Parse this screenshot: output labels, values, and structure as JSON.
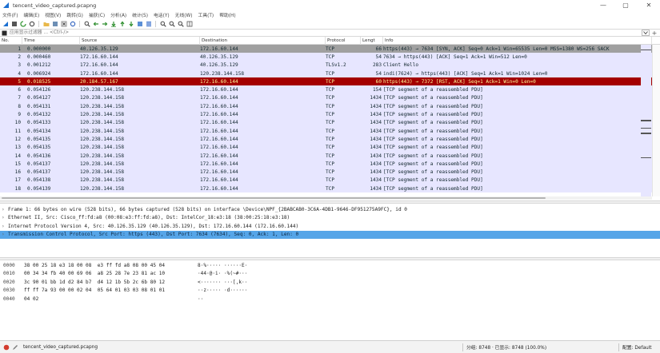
{
  "window": {
    "title": "tencent_video_captured.pcapng",
    "minimize": "—",
    "maximize": "▢",
    "close": "✕"
  },
  "menu": [
    "文件(F)",
    "编辑(E)",
    "视图(V)",
    "跳转(G)",
    "捕获(C)",
    "分析(A)",
    "统计(S)",
    "电话(Y)",
    "无线(W)",
    "工具(T)",
    "帮助(H)"
  ],
  "filter": {
    "placeholder": "应用显示过滤器 … <Ctrl-/>",
    "plus": "+"
  },
  "packet_list": {
    "headers": [
      "No.",
      "Time",
      "Source",
      "Destination",
      "Protocol",
      "Lengt",
      "Info"
    ],
    "rows": [
      {
        "no": "1",
        "time": "0.000000",
        "src": "40.126.35.129",
        "dst": "172.16.60.144",
        "proto": "TCP",
        "len": "66",
        "info": "https(443) → 7634 [SYN, ACK] Seq=0 Ack=1 Win=65535 Len=0 MSS=1380 WS=256 SACK"
      },
      {
        "no": "2",
        "time": "0.000460",
        "src": "172.16.60.144",
        "dst": "40.126.35.129",
        "proto": "TCP",
        "len": "54",
        "info": "7634 → https(443) [ACK] Seq=1 Ack=1 Win=512 Len=0"
      },
      {
        "no": "3",
        "time": "0.001212",
        "src": "172.16.60.144",
        "dst": "40.126.35.129",
        "proto": "TLSv1.2",
        "len": "283",
        "info": "Client Hello"
      },
      {
        "no": "4",
        "time": "0.006924",
        "src": "172.16.60.144",
        "dst": "120.238.144.158",
        "proto": "TCP",
        "len": "54",
        "info": "indi(7624) → https(443) [ACK] Seq=1 Ack=1 Win=1024 Len=0"
      },
      {
        "no": "5",
        "time": "0.018525",
        "src": "20.184.57.167",
        "dst": "172.16.60.144",
        "proto": "TCP",
        "len": "60",
        "info": "https(443) → 7372 [RST, ACK] Seq=1 Ack=1 Win=0 Len=0"
      },
      {
        "no": "6",
        "time": "0.054126",
        "src": "120.238.144.158",
        "dst": "172.16.60.144",
        "proto": "TCP",
        "len": "154",
        "info": "[TCP segment of a reassembled PDU]"
      },
      {
        "no": "7",
        "time": "0.054127",
        "src": "120.238.144.158",
        "dst": "172.16.60.144",
        "proto": "TCP",
        "len": "1434",
        "info": "[TCP segment of a reassembled PDU]"
      },
      {
        "no": "8",
        "time": "0.054131",
        "src": "120.238.144.158",
        "dst": "172.16.60.144",
        "proto": "TCP",
        "len": "1434",
        "info": "[TCP segment of a reassembled PDU]"
      },
      {
        "no": "9",
        "time": "0.054132",
        "src": "120.238.144.158",
        "dst": "172.16.60.144",
        "proto": "TCP",
        "len": "1434",
        "info": "[TCP segment of a reassembled PDU]"
      },
      {
        "no": "10",
        "time": "0.054133",
        "src": "120.238.144.158",
        "dst": "172.16.60.144",
        "proto": "TCP",
        "len": "1434",
        "info": "[TCP segment of a reassembled PDU]"
      },
      {
        "no": "11",
        "time": "0.054134",
        "src": "120.238.144.158",
        "dst": "172.16.60.144",
        "proto": "TCP",
        "len": "1434",
        "info": "[TCP segment of a reassembled PDU]"
      },
      {
        "no": "12",
        "time": "0.054135",
        "src": "120.238.144.158",
        "dst": "172.16.60.144",
        "proto": "TCP",
        "len": "1434",
        "info": "[TCP segment of a reassembled PDU]"
      },
      {
        "no": "13",
        "time": "0.054135",
        "src": "120.238.144.158",
        "dst": "172.16.60.144",
        "proto": "TCP",
        "len": "1434",
        "info": "[TCP segment of a reassembled PDU]"
      },
      {
        "no": "14",
        "time": "0.054136",
        "src": "120.238.144.158",
        "dst": "172.16.60.144",
        "proto": "TCP",
        "len": "1434",
        "info": "[TCP segment of a reassembled PDU]"
      },
      {
        "no": "15",
        "time": "0.054137",
        "src": "120.238.144.158",
        "dst": "172.16.60.144",
        "proto": "TCP",
        "len": "1434",
        "info": "[TCP segment of a reassembled PDU]"
      },
      {
        "no": "16",
        "time": "0.054137",
        "src": "120.238.144.158",
        "dst": "172.16.60.144",
        "proto": "TCP",
        "len": "1434",
        "info": "[TCP segment of a reassembled PDU]"
      },
      {
        "no": "17",
        "time": "0.054138",
        "src": "120.238.144.158",
        "dst": "172.16.60.144",
        "proto": "TCP",
        "len": "1434",
        "info": "[TCP segment of a reassembled PDU]"
      },
      {
        "no": "18",
        "time": "0.054139",
        "src": "120.238.144.158",
        "dst": "172.16.60.144",
        "proto": "TCP",
        "len": "1434",
        "info": "[TCP segment of a reassembled PDU]"
      }
    ]
  },
  "details": [
    "Frame 1: 66 bytes on wire (528 bits), 66 bytes captured (528 bits) on interface \\Device\\NPF_{2BABCAB0-3C6A-4DB1-9646-DF951275A9FC}, id 0",
    "Ethernet II, Src: Cisco_ff:fd:a8 (00:08:e3:ff:fd:a8), Dst: IntelCor_18:e3:18 (38:00:25:18:e3:18)",
    "Internet Protocol Version 4, Src: 40.126.35.129 (40.126.35.129), Dst: 172.16.60.144 (172.16.60.144)",
    "Transmission Control Protocol, Src Port: https (443), Dst Port: 7634 (7634), Seq: 0, Ack: 1, Len: 0"
  ],
  "bytes": [
    {
      "off": "0000",
      "hex": "38 00 25 18 e3 18 00 08  e3 ff fd a8 08 00 45 04",
      "ascii": "8·%····· ······E·"
    },
    {
      "off": "0010",
      "hex": "00 34 34 fb 40 00 69 06  a8 25 28 7e 23 81 ac 10",
      "ascii": "·44·@·i· ·%(~#···"
    },
    {
      "off": "0020",
      "hex": "3c 90 01 bb 1d d2 84 b7  d4 12 1b 5b 2c 6b 80 12",
      "ascii": "<······· ···[,k··"
    },
    {
      "off": "0030",
      "hex": "ff ff 7a 93 00 00 02 04  05 64 01 03 03 08 01 01",
      "ascii": "··z····· ·d······"
    },
    {
      "off": "0040",
      "hex": "04 02",
      "ascii": "··"
    }
  ],
  "status": {
    "file": "tencent_video_captured.pcapng",
    "stats": "分组: 8748 · 已显示: 8748 (100.0%)",
    "profile": "配置: Default"
  }
}
